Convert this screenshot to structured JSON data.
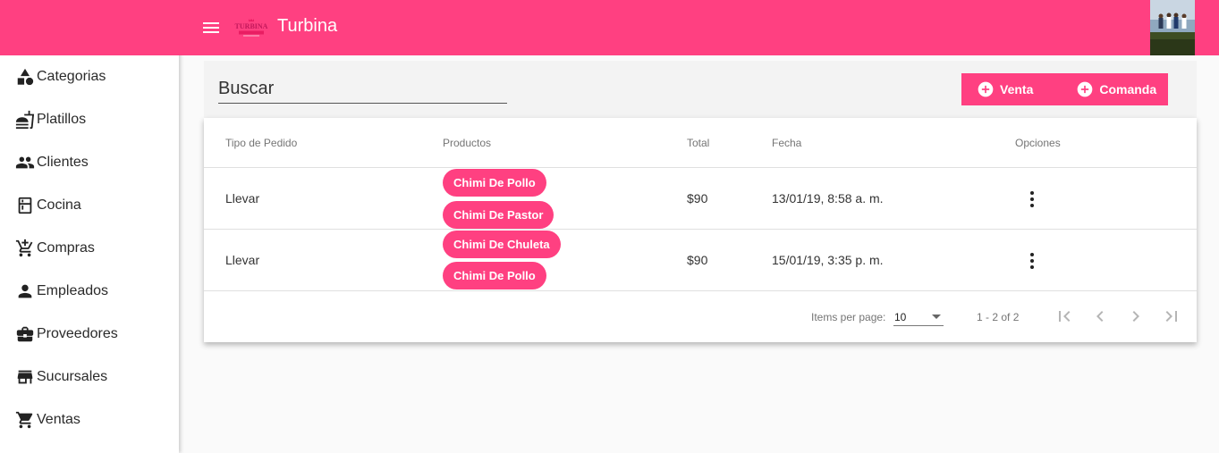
{
  "header": {
    "app_title": "Turbina",
    "logo_text": "TURBINA",
    "colors": {
      "primary": "#ff4081",
      "header_text": "#ffffff"
    }
  },
  "sidebar": {
    "items": [
      {
        "label": "Categorias",
        "icon": "category-shapes-icon"
      },
      {
        "label": "Platillos",
        "icon": "food-tray-icon"
      },
      {
        "label": "Clientes",
        "icon": "people-icon"
      },
      {
        "label": "Cocina",
        "icon": "kitchen-icon"
      },
      {
        "label": "Compras",
        "icon": "add-shopping-cart-icon"
      },
      {
        "label": "Empleados",
        "icon": "person-icon"
      },
      {
        "label": "Proveedores",
        "icon": "briefcase-icon"
      },
      {
        "label": "Sucursales",
        "icon": "store-icon"
      },
      {
        "label": "Ventas",
        "icon": "shopping-cart-icon"
      }
    ]
  },
  "search": {
    "placeholder": "Buscar"
  },
  "actions": {
    "venta_label": "Venta",
    "comanda_label": "Comanda"
  },
  "table": {
    "headers": {
      "tipo": "Tipo de Pedido",
      "productos": "Productos",
      "total": "Total",
      "fecha": "Fecha",
      "opciones": "Opciones"
    },
    "rows": [
      {
        "tipo": "Llevar",
        "productos": [
          "Chimi De Pollo",
          "Chimi De Pastor"
        ],
        "total": "$90",
        "fecha": "13/01/19, 8:58 a. m."
      },
      {
        "tipo": "Llevar",
        "productos": [
          "Chimi De Chuleta",
          "Chimi De Pollo"
        ],
        "total": "$90",
        "fecha": "15/01/19, 3:35 p. m."
      }
    ]
  },
  "paginator": {
    "items_label": "Items per page:",
    "page_size": "10",
    "range_label": "1 - 2 of 2"
  }
}
